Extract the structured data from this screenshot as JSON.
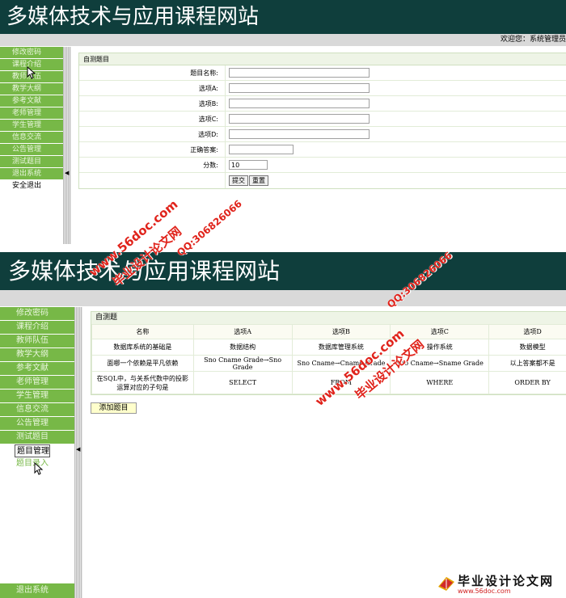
{
  "site_title": "多媒体技术与应用课程网站",
  "welcome_text": "欢迎您：系统管理员",
  "screen1": {
    "menu": [
      "修改密码",
      "课程介绍",
      "教师队伍",
      "教学大纲",
      "参考文献",
      "老师管理",
      "学生管理",
      "信息交流",
      "公告管理",
      "测试题目",
      "退出系统"
    ],
    "menu_plain": "安全退出",
    "panel_title": "自测题目",
    "form": {
      "question_label": "题目名称:",
      "option_a_label": "选项A:",
      "option_b_label": "选项B:",
      "option_c_label": "选项C:",
      "option_d_label": "选项D:",
      "answer_label": "正确答案:",
      "score_label": "分数:",
      "score_value": "10",
      "submit_label": "提交",
      "reset_label": "重置"
    }
  },
  "screen2": {
    "menu": [
      "修改密码",
      "课程介绍",
      "教师队伍",
      "教学大纲",
      "参考文献",
      "老师管理",
      "学生管理",
      "信息交流",
      "公告管理",
      "测试题目"
    ],
    "submenu_active": "题目管理",
    "submenu_item": "题目录入",
    "exit_label": "退出系统",
    "panel_title": "自测题",
    "table": {
      "headers": [
        "名称",
        "选项A",
        "选项B",
        "选项C",
        "选项D"
      ],
      "rows": [
        [
          "数据库系统的基础是",
          "数据结构",
          "数据库管理系统",
          "操作系统",
          "数据模型"
        ],
        [
          "面哪一个依赖是平凡依赖",
          "Sno Cname Grade→Sno Grade",
          "Sno Cname→Cname Grade",
          "Sno Cname→Sname Grade",
          "以上答案都不是"
        ],
        [
          "在SQL中，与关系代数中的投影运算对应的子句是",
          "SELECT",
          "FROM",
          "WHERE",
          "ORDER BY"
        ]
      ]
    },
    "add_button": "添加题目"
  },
  "watermarks": {
    "url": "www.56doc.com",
    "qq": "QQ:306826066",
    "brand": "毕业设计论文网"
  },
  "logo": {
    "name": "毕业设计论文网",
    "url": "www.56doc.com"
  },
  "colors": {
    "banner": "#0f3e3c",
    "menu_green": "#77b847",
    "watermark_red": "#e0231b"
  }
}
